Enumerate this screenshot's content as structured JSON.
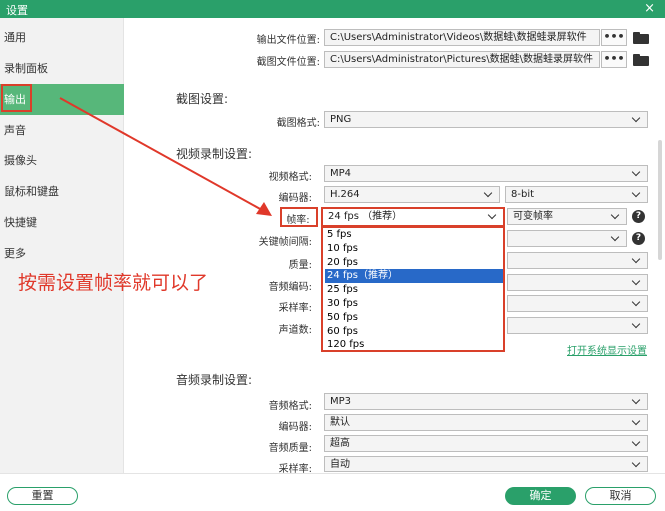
{
  "window": {
    "title": "设置",
    "close_icon": "×"
  },
  "sidebar": {
    "items": [
      {
        "label": "通用"
      },
      {
        "label": "录制面板"
      },
      {
        "label": "输出"
      },
      {
        "label": "声音"
      },
      {
        "label": "摄像头"
      },
      {
        "label": "鼠标和键盘"
      },
      {
        "label": "快捷键"
      },
      {
        "label": "更多"
      }
    ],
    "active_index": 2
  },
  "output": {
    "output_location_label": "输出文件位置:",
    "output_location_value": "C:\\Users\\Administrator\\Videos\\数据蛙\\数据蛙录屏软件",
    "screenshot_location_label": "截图文件位置:",
    "screenshot_location_value": "C:\\Users\\Administrator\\Pictures\\数据蛙\\数据蛙录屏软件",
    "dots_label": "•••"
  },
  "screenshot_settings": {
    "section_title": "截图设置:",
    "format_label": "截图格式:",
    "format_value": "PNG"
  },
  "video_settings": {
    "section_title": "视频录制设置:",
    "format_label": "视频格式:",
    "format_value": "MP4",
    "encoder_label": "编码器:",
    "encoder_value": "H.264",
    "bitdepth_value": "8-bit",
    "framerate_label": "帧率:",
    "framerate_value": "24 fps （推荐）",
    "framerate_mode_value": "可变帧率",
    "keyframe_label": "关键帧间隔:",
    "quality_label": "质量:",
    "audio_encoder_label": "音频编码:",
    "samplerate_label": "采样率:",
    "channels_label": "声道数:",
    "framerate_options": [
      "5 fps",
      "10 fps",
      "20 fps",
      "24 fps（推荐）",
      "25 fps",
      "30 fps",
      "50 fps",
      "60 fps",
      "120 fps"
    ],
    "framerate_selected_index": 3,
    "display_settings_link": "打开系统显示设置"
  },
  "audio_settings": {
    "section_title": "音频录制设置:",
    "format_label": "音频格式:",
    "format_value": "MP3",
    "encoder_label": "编码器:",
    "encoder_value": "默认",
    "quality_label": "音频质量:",
    "quality_value": "超高",
    "samplerate_label": "采样率:",
    "samplerate_value": "自动"
  },
  "footer": {
    "reset_label": "重置",
    "ok_label": "确定",
    "cancel_label": "取消"
  },
  "annotation": {
    "text": "按需设置帧率就可以了"
  },
  "colors": {
    "accent": "#2aa06a",
    "highlight": "#d9402a",
    "selection": "#2869c8"
  }
}
